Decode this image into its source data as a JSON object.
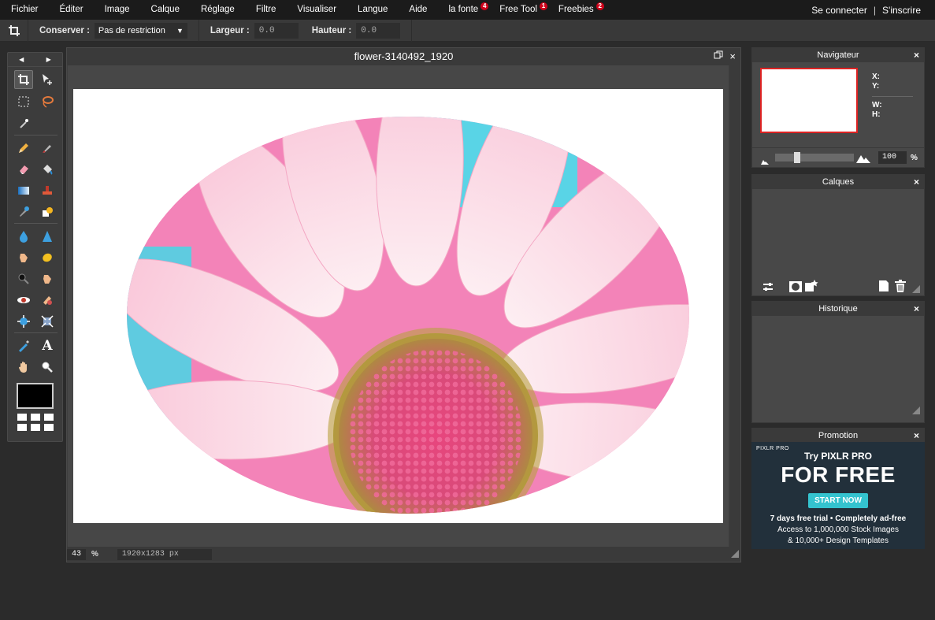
{
  "menu": {
    "items": [
      {
        "label": "Fichier"
      },
      {
        "label": "Éditer"
      },
      {
        "label": "Image"
      },
      {
        "label": "Calque"
      },
      {
        "label": "Réglage"
      },
      {
        "label": "Filtre"
      },
      {
        "label": "Visualiser"
      },
      {
        "label": "Langue"
      },
      {
        "label": "Aide"
      },
      {
        "label": "la fonte",
        "badge": "4"
      },
      {
        "label": "Free Tool",
        "badge": "1"
      },
      {
        "label": "Freebies",
        "badge": "2"
      }
    ],
    "login": "Se connecter",
    "separator": "|",
    "signup": "S'inscrire"
  },
  "options": {
    "keep_label": "Conserver :",
    "keep_value": "Pas de restriction",
    "width_label": "Largeur :",
    "width_value": "0.0",
    "height_label": "Hauteur :",
    "height_value": "0.0"
  },
  "document": {
    "title": "flower-3140492_1920",
    "zoom": "43",
    "zoom_unit": "%",
    "dimensions": "1920x1283 px"
  },
  "panels": {
    "navigator": {
      "title": "Navigateur",
      "x_label": "X:",
      "y_label": "Y:",
      "w_label": "W:",
      "h_label": "H:",
      "zoom_value": "100",
      "zoom_unit": "%"
    },
    "layers": {
      "title": "Calques"
    },
    "history": {
      "title": "Historique"
    },
    "promotion": {
      "title": "Promotion"
    },
    "close_glyph": "×"
  },
  "promo": {
    "logo": "PIXLR PRO",
    "headline_small": "Try PIXLR PRO",
    "headline_big": "FOR FREE",
    "cta": "START NOW",
    "line1": "7 days free trial • Completely ad-free",
    "line2": "Access to 1,000,000 Stock Images",
    "line3": "& 10,000+ Design Templates"
  },
  "colors": {
    "accent_badge": "#d0021b",
    "promo_cta": "#34c3cf",
    "foreground_color": "#000000"
  }
}
